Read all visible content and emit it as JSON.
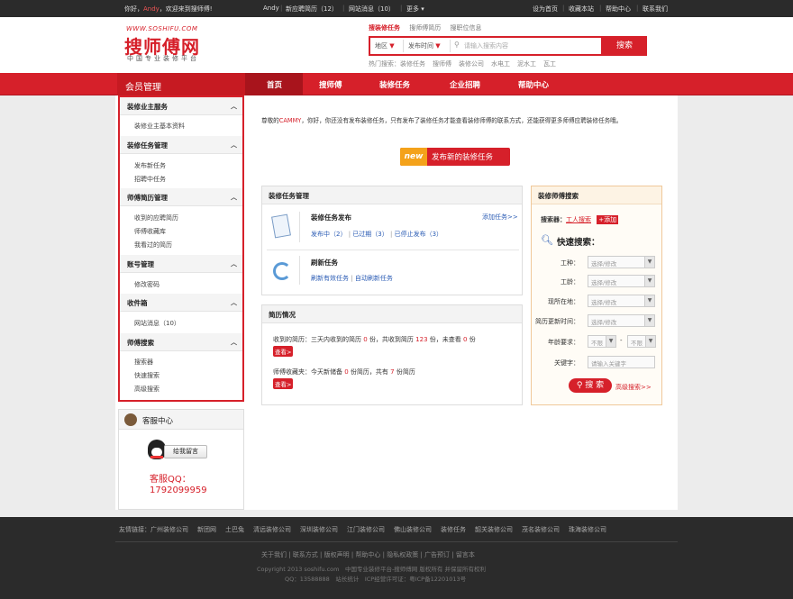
{
  "topbar": {
    "welcome": "你好，",
    "user_link": "Andy",
    "welcome_tail": "，欢迎来到搜师傅!",
    "username": "Andy",
    "new_resume": "新应聘简历（12）",
    "site_msg": "网站消息（10）",
    "more": "更多",
    "set_home": "设为首页",
    "bookmark": "收藏本站",
    "help": "帮助中心",
    "contact": "联系我们"
  },
  "logo": {
    "url_text": "WWW.SOSHIFU.COM",
    "name": "搜师傅网",
    "slogan": "中国专业装修平台"
  },
  "search": {
    "tabs": [
      "搜装修任务",
      "搜师傅简历",
      "搜职位信息"
    ],
    "region": "地区",
    "publish_time": "发布时间",
    "placeholder": "请输入搜索内容",
    "button": "搜索",
    "hot_label": "热门搜索：",
    "hot": [
      "装修任务",
      "搜师傅",
      "装修公司",
      "水电工",
      "泥水工",
      "瓦工"
    ]
  },
  "nav": {
    "member_title": "会员管理",
    "items": [
      "首页",
      "搜师傅",
      "装修任务",
      "企业招聘",
      "帮助中心"
    ]
  },
  "sidebar": {
    "sections": [
      {
        "title": "装修业主服务",
        "items": [
          "装修业主基本资料"
        ]
      },
      {
        "title": "装修任务管理",
        "items": [
          "发布新任务",
          "招聘中任务"
        ]
      },
      {
        "title": "师傅简历管理",
        "items": [
          "收到的应聘简历",
          "师傅收藏库",
          "我看过的简历"
        ]
      },
      {
        "title": "账号管理",
        "items": [
          "修改密码"
        ]
      },
      {
        "title": "收件箱",
        "items": [
          "网站消息（10）"
        ]
      },
      {
        "title": "师傅搜索",
        "items": [
          "搜索器",
          "快速搜索",
          "高级搜索"
        ]
      }
    ]
  },
  "customer_service": {
    "title": "客服中心",
    "leave_msg": "给我留言",
    "qq_label": "客服QQ：",
    "qq": "1792099959"
  },
  "notice": {
    "prefix": "尊敬的",
    "user": "CAMMY",
    "text": "，你好，你还没有发布装修任务，只有发布了装修任务才能查看装修师傅的联系方式，还能获得更多师傅应聘装修任务哦。",
    "new_badge": "new",
    "publish_button": "发布新的装修任务"
  },
  "task_panel": {
    "title": "装修任务管理",
    "publish_title": "装修任务发布",
    "add_link": "添加任务>>",
    "publishing": "发布中（2）",
    "expired": "已过期（3）",
    "stopped": "已停止发布（3）",
    "refresh_title": "刷新任务",
    "refresh_valid": "刷新有效任务",
    "auto_refresh": "自动刷新任务"
  },
  "resume_panel": {
    "title": "简历情况",
    "received_a": "收到的简历：三天内收到的简历",
    "received_n1": "0",
    "received_b": "份，共收到简历",
    "received_n2": "123",
    "received_c": "份，未查看",
    "received_n3": "0",
    "received_d": "份",
    "view": "查看>",
    "fav_a": "师傅收藏夹：今天新储备",
    "fav_n1": "0",
    "fav_b": "份简历，共有",
    "fav_n2": "7",
    "fav_c": "份简历",
    "view2": "查看>"
  },
  "search_panel": {
    "title": "装修师傅搜索",
    "searcher_label": "搜索器：",
    "searcher_link": "工人搜索",
    "add": "添加",
    "quick": "快速搜索：",
    "fields": [
      {
        "label": "工种：",
        "value": "选择/修改"
      },
      {
        "label": "工龄：",
        "value": "选择/修改"
      },
      {
        "label": "现所在地：",
        "value": "选择/修改"
      },
      {
        "label": "简历更新时间：",
        "value": "选择/修改"
      }
    ],
    "age_label": "年龄要求：",
    "age_from": "不限",
    "age_dash": "-",
    "age_to": "不限",
    "keyword_label": "关键字：",
    "keyword_placeholder": "请输入关键字",
    "search_btn": "搜 索",
    "advanced": "高级搜索>>"
  },
  "footer": {
    "links_label": "友情链接：",
    "links": [
      "广州装修公司",
      "新团网",
      "土巴兔",
      "清远装修公司",
      "深圳装修公司",
      "江门装修公司",
      "佛山装修公司",
      "装修任务",
      "韶关装修公司",
      "茂名装修公司",
      "珠海装修公司"
    ],
    "bottom": [
      "关于我们",
      "联系方式",
      "版权声明",
      "帮助中心",
      "隐私权政策",
      "广告预订",
      "留言本"
    ],
    "copyright": "Copyright 2013 soshifu.com　中国专业装修平台-搜师傅网 版权所有 并保留所有权利",
    "icp": "QQ：13588888　站长统计　ICP经营许可证：粤ICP备12201013号"
  },
  "colors": {
    "brand_red": "#d6202a",
    "dark": "#2b2b2b",
    "link_blue": "#2c5db5"
  }
}
